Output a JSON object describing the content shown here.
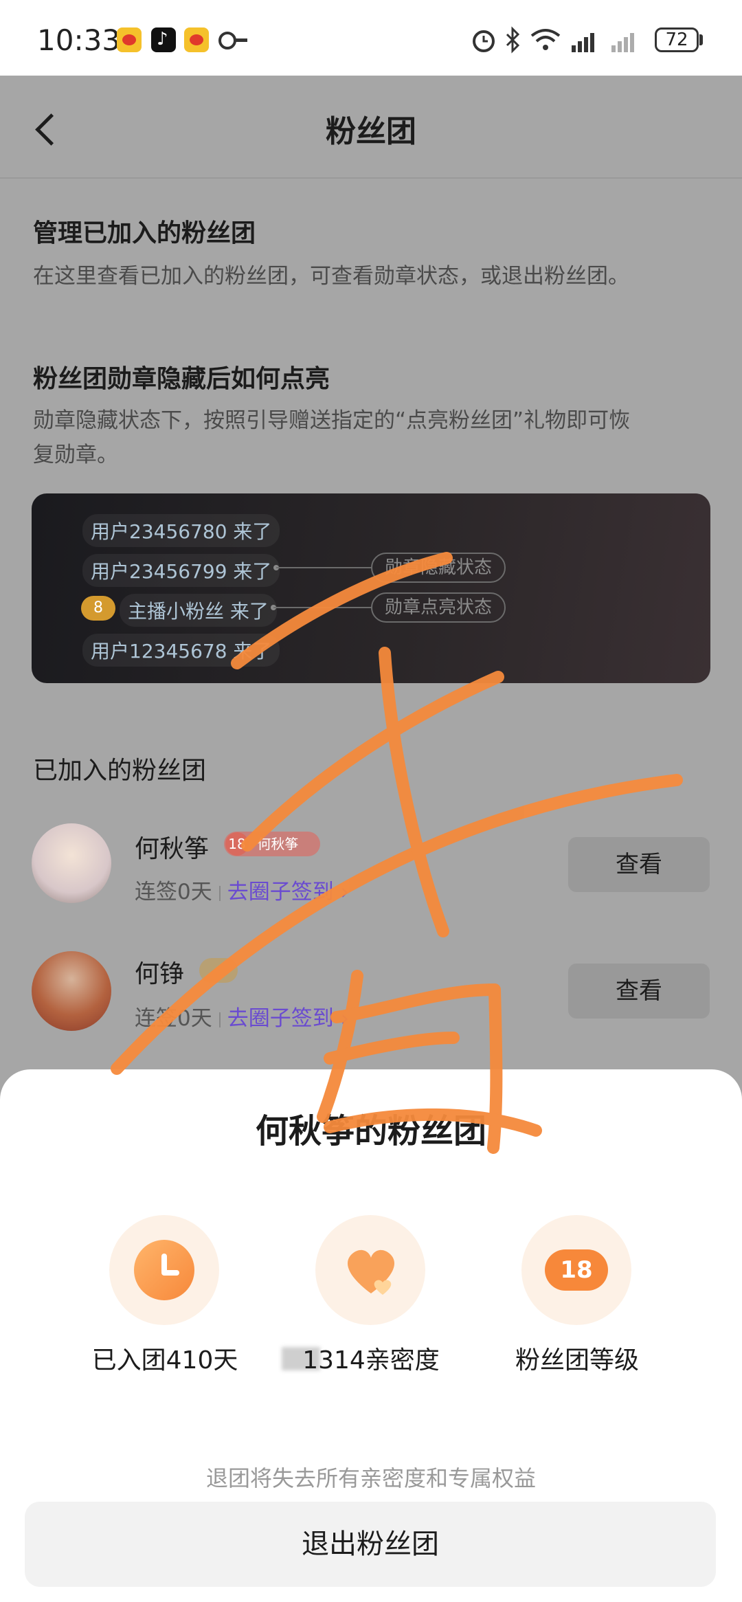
{
  "status_bar": {
    "time": "10:33",
    "battery": "72",
    "icons": [
      "weibo-icon",
      "tiktok-icon",
      "weibo-icon",
      "key-icon",
      "alarm-icon",
      "bluetooth-icon",
      "wifi-icon",
      "signal-icon",
      "signal-icon"
    ]
  },
  "header": {
    "title": "粉丝团"
  },
  "manage": {
    "heading": "管理已加入的粉丝团",
    "description": "在这里查看已加入的粉丝团，可查看勋章状态，或退出粉丝团。"
  },
  "hidden_badge": {
    "heading": "粉丝团勋章隐藏后如何点亮",
    "description_line1": "勋章隐藏状态下，按照引导赠送指定的“点亮粉丝团”礼物即可恢",
    "description_line2": "复勋章。"
  },
  "demo": {
    "rows": [
      "用户23456780 来了",
      "用户23456799 来了",
      "主播小粉丝 来了",
      "用户12345678 来了"
    ],
    "badge_level": "8",
    "hidden_state_label": "勋章隐藏状态",
    "lit_state_label": "勋章点亮状态"
  },
  "joined": {
    "heading": "已加入的粉丝团",
    "items": [
      {
        "name": "何秋筝",
        "badge_level": "18",
        "badge_name": "何秋筝",
        "streak": "连签0天",
        "link": "去圈子签到 ›",
        "button": "查看"
      },
      {
        "name": "何铮",
        "badge_level": "",
        "badge_name": "",
        "streak": "连签0天",
        "link": "去圈子签到 ›",
        "button": "查看"
      }
    ]
  },
  "sheet": {
    "title": "何秋筝的粉丝团",
    "stats": [
      {
        "label": "已入团410天",
        "icon": "clock-icon"
      },
      {
        "label": "1314亲密度",
        "icon": "heart-icon"
      },
      {
        "label": "粉丝团等级",
        "icon": "level-badge-icon",
        "value": "18"
      }
    ],
    "note": "退团将失去所有亲密度和专属权益",
    "quit_button": "退出粉丝团"
  },
  "colors": {
    "overlay": "#a6a6a6",
    "accent_orange": "#f7883a",
    "link_purple": "#6a4bd0",
    "scribble": "#f58a3c"
  }
}
